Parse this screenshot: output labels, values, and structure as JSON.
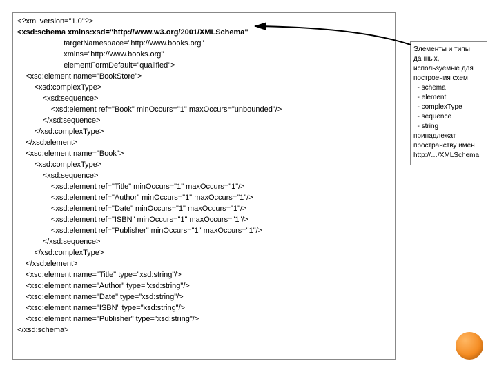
{
  "codeLines": [
    {
      "indent": 0,
      "text": "<?xml version=\"1.0\"?>",
      "bold": false
    },
    {
      "indent": 0,
      "text": "<xsd:schema xmlns:xsd=\"http://www.w3.org/2001/XMLSchema\"",
      "bold": true
    },
    {
      "indent": 5,
      "text": "targetNamespace=\"http://www.books.org\"",
      "bold": false
    },
    {
      "indent": 5,
      "text": "xmlns=\"http://www.books.org\"",
      "bold": false
    },
    {
      "indent": 5,
      "text": "elementFormDefault=\"qualified\">",
      "bold": false
    },
    {
      "indent": 1,
      "text": "<xsd:element name=\"BookStore\">",
      "bold": false
    },
    {
      "indent": 2,
      "text": "<xsd:complexType>",
      "bold": false
    },
    {
      "indent": 3,
      "text": "<xsd:sequence>",
      "bold": false
    },
    {
      "indent": 4,
      "text": "<xsd:element ref=\"Book\" minOccurs=\"1\" maxOccurs=\"unbounded\"/>",
      "bold": false
    },
    {
      "indent": 3,
      "text": "</xsd:sequence>",
      "bold": false
    },
    {
      "indent": 2,
      "text": "</xsd:complexType>",
      "bold": false
    },
    {
      "indent": 1,
      "text": "</xsd:element>",
      "bold": false
    },
    {
      "indent": 1,
      "text": "<xsd:element name=\"Book\">",
      "bold": false
    },
    {
      "indent": 2,
      "text": "<xsd:complexType>",
      "bold": false
    },
    {
      "indent": 3,
      "text": "<xsd:sequence>",
      "bold": false
    },
    {
      "indent": 4,
      "text": "<xsd:element ref=\"Title\" minOccurs=\"1\" maxOccurs=\"1\"/>",
      "bold": false
    },
    {
      "indent": 4,
      "text": "<xsd:element ref=\"Author\" minOccurs=\"1\" maxOccurs=\"1\"/>",
      "bold": false
    },
    {
      "indent": 4,
      "text": "<xsd:element ref=\"Date\" minOccurs=\"1\" maxOccurs=\"1\"/>",
      "bold": false
    },
    {
      "indent": 4,
      "text": "<xsd:element ref=\"ISBN\" minOccurs=\"1\" maxOccurs=\"1\"/>",
      "bold": false
    },
    {
      "indent": 4,
      "text": "<xsd:element ref=\"Publisher\" minOccurs=\"1\" maxOccurs=\"1\"/>",
      "bold": false
    },
    {
      "indent": 3,
      "text": "</xsd:sequence>",
      "bold": false
    },
    {
      "indent": 2,
      "text": "</xsd:complexType>",
      "bold": false
    },
    {
      "indent": 1,
      "text": "</xsd:element>",
      "bold": false
    },
    {
      "indent": 1,
      "text": "<xsd:element name=\"Title\" type=\"xsd:string\"/>",
      "bold": false
    },
    {
      "indent": 1,
      "text": "<xsd:element name=\"Author\" type=\"xsd:string\"/>",
      "bold": false
    },
    {
      "indent": 1,
      "text": "<xsd:element name=\"Date\" type=\"xsd:string\"/>",
      "bold": false
    },
    {
      "indent": 1,
      "text": "<xsd:element name=\"ISBN\" type=\"xsd:string\"/>",
      "bold": false
    },
    {
      "indent": 1,
      "text": "<xsd:element name=\"Publisher\" type=\"xsd:string\"/>",
      "bold": false
    },
    {
      "indent": 0,
      "text": "</xsd:schema>",
      "bold": false
    }
  ],
  "annotation": {
    "paragraph1": "Элементы и типы данных, используемые для построения схем",
    "items": [
      "schema",
      "element",
      "complexType",
      "sequence",
      "string"
    ],
    "paragraph2": "принадлежат пространству имен http://…/XMLSchema"
  }
}
